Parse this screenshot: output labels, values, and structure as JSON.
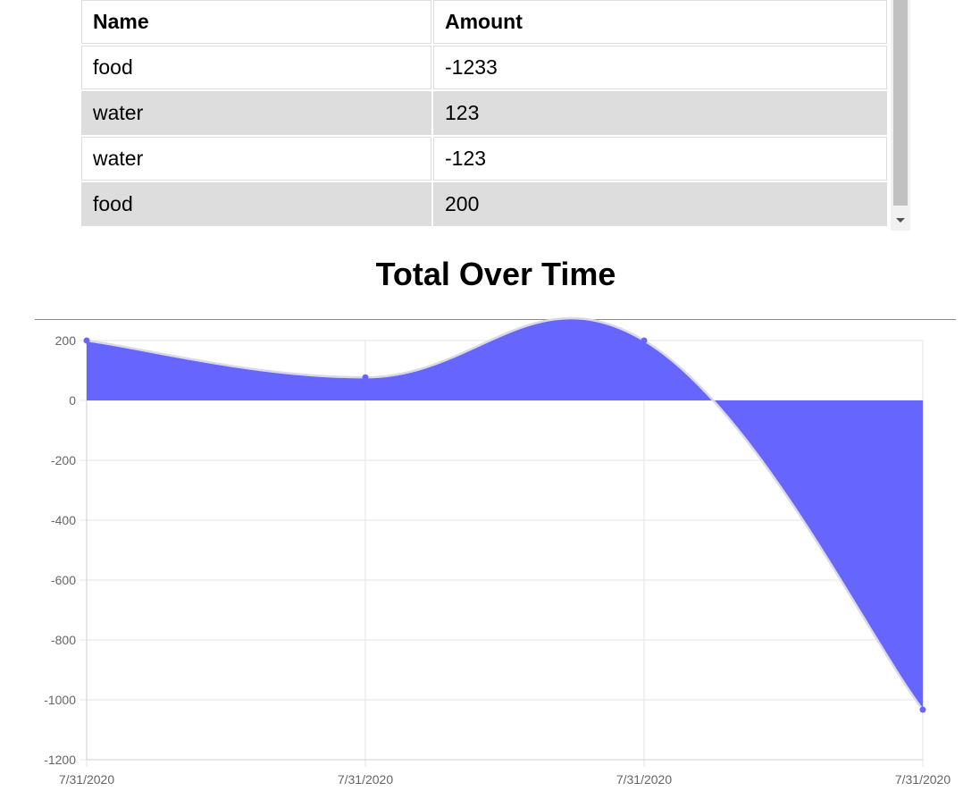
{
  "table": {
    "headers": {
      "name": "Name",
      "amount": "Amount"
    },
    "rows": [
      {
        "name": "food",
        "amount": "-1233"
      },
      {
        "name": "water",
        "amount": "123"
      },
      {
        "name": "water",
        "amount": "-123"
      },
      {
        "name": "food",
        "amount": "200"
      }
    ]
  },
  "chart_title": "Total Over Time",
  "chart_data": {
    "type": "area",
    "title": "Total Over Time",
    "xlabel": "",
    "ylabel": "",
    "x": [
      "7/31/2020",
      "7/31/2020",
      "7/31/2020",
      "7/31/2020"
    ],
    "series": [
      {
        "values": [
          200,
          77,
          200,
          -1033
        ]
      }
    ],
    "ylim": [
      -1200,
      200
    ],
    "yticks": [
      200,
      0,
      -200,
      -400,
      -600,
      -800,
      -1000,
      -1200
    ],
    "grid": true,
    "legend": "none",
    "fill_color": "#6666ff",
    "line_color": "#d8d8e8",
    "point_color": "#6666ff"
  }
}
